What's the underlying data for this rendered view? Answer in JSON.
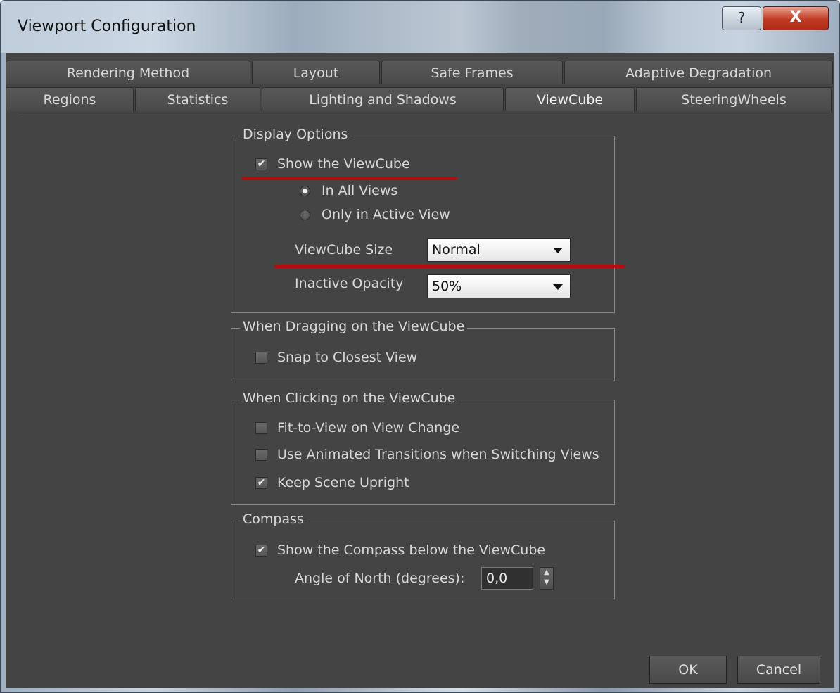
{
  "window": {
    "title": "Viewport Configuration",
    "help_glyph": "?",
    "close_glyph": "X"
  },
  "tabs": {
    "row1": [
      "Rendering Method",
      "Layout",
      "Safe Frames",
      "Adaptive Degradation"
    ],
    "row2": [
      "Regions",
      "Statistics",
      "Lighting and Shadows",
      "ViewCube",
      "SteeringWheels"
    ],
    "active": "ViewCube"
  },
  "display_options": {
    "label": "Display Options",
    "show_viewcube": {
      "label": "Show the ViewCube",
      "checked": true
    },
    "in_all_views": {
      "label": "In All Views",
      "selected": true
    },
    "only_active": {
      "label": "Only in Active View",
      "selected": false
    },
    "size_label": "ViewCube Size",
    "size_value": "Normal",
    "opacity_label": "Inactive Opacity",
    "opacity_value": "50%"
  },
  "dragging": {
    "label": "When Dragging on the ViewCube",
    "snap": {
      "label": "Snap to Closest View",
      "checked": false
    }
  },
  "clicking": {
    "label": "When Clicking on the ViewCube",
    "fit": {
      "label": "Fit-to-View on View Change",
      "checked": false
    },
    "animated": {
      "label": "Use Animated Transitions when Switching Views",
      "checked": false
    },
    "upright": {
      "label": "Keep Scene Upright",
      "checked": true
    }
  },
  "compass": {
    "label": "Compass",
    "show": {
      "label": "Show the Compass below the ViewCube",
      "checked": true
    },
    "angle_label": "Angle of North (degrees):",
    "angle_value": "0,0"
  },
  "buttons": {
    "ok": "OK",
    "cancel": "Cancel"
  },
  "colors": {
    "client_bg": "#444444",
    "highlight_line": "#b10d0d"
  }
}
